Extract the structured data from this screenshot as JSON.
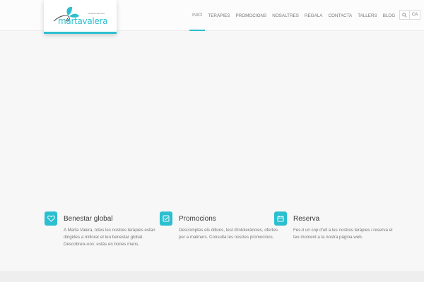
{
  "brand": {
    "tagline": "Terapia Holística",
    "name": "martavalera",
    "accent": "#2bbfcf"
  },
  "nav": {
    "items": [
      {
        "label": "Inici",
        "active": true
      },
      {
        "label": "Teràpies"
      },
      {
        "label": "Promocions"
      },
      {
        "label": "Nosaltres"
      },
      {
        "label": "Regala"
      },
      {
        "label": "Contacta"
      },
      {
        "label": "Tallers"
      },
      {
        "label": "Blog"
      }
    ]
  },
  "tools": {
    "search_icon": "search-icon",
    "language": "CA"
  },
  "features": [
    {
      "icon": "heart-icon",
      "title": "Benestar global",
      "text": "A Marta Valera, totes les nostres teràpies estan dirigides a millorar el teu benestar global. Descobreix-nos: estàs en bones mans."
    },
    {
      "icon": "checkbox-icon",
      "title": "Promocions",
      "text": "Descomptes els dilluns, test d'intoleràncies, ofertes per a matiners. Consulta les nostres promocions."
    },
    {
      "icon": "calendar-icon",
      "title": "Reserva",
      "text": "Fes-li un cop d'ull a les nostres teràpies i reserva el teu moment a la nostra pàgina web."
    }
  ]
}
